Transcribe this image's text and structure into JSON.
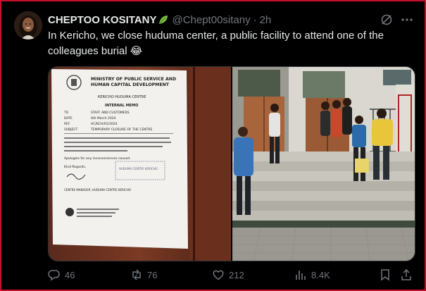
{
  "tweet": {
    "author_name": "CHEPTOO KOSITANY",
    "author_badge_icon": "leaf-icon",
    "handle": "@Chept00sitany",
    "separator": "·",
    "time": "2h",
    "text": "In Kericho, we close huduma center, a public facility to attend one of the colleagues burial 😂",
    "media": [
      {
        "kind": "memo-photo",
        "heading": "MINISTRY OF PUBLIC SERVICE AND HUMAN CAPITAL DEVELOPMENT",
        "subheading": "KERICHO HUDUMA CENTRE",
        "memo_title": "INTERNAL MEMO",
        "to": "STAFF AND CUSTOMERS",
        "date": "6th March 2024",
        "ref": "HC/KCH/01/2024",
        "subject": "TEMPORARY CLOSURE OF THE CENTRE",
        "apology": "Apologies for any inconveniences caused.",
        "regards": "Kind Regards,",
        "signatory": "CENTRE MANAGER, HUDUMA CENTRE KERICHO",
        "stamp": "HUDUMA CENTRE KERICHO"
      },
      {
        "kind": "building-photo"
      }
    ],
    "stats": {
      "replies": "46",
      "reposts": "76",
      "likes": "212",
      "views": "8.4K"
    }
  },
  "colors": {
    "background": "#000000",
    "text": "#e7e9ea",
    "muted": "#71767b",
    "border_frame": "#c8102e"
  }
}
